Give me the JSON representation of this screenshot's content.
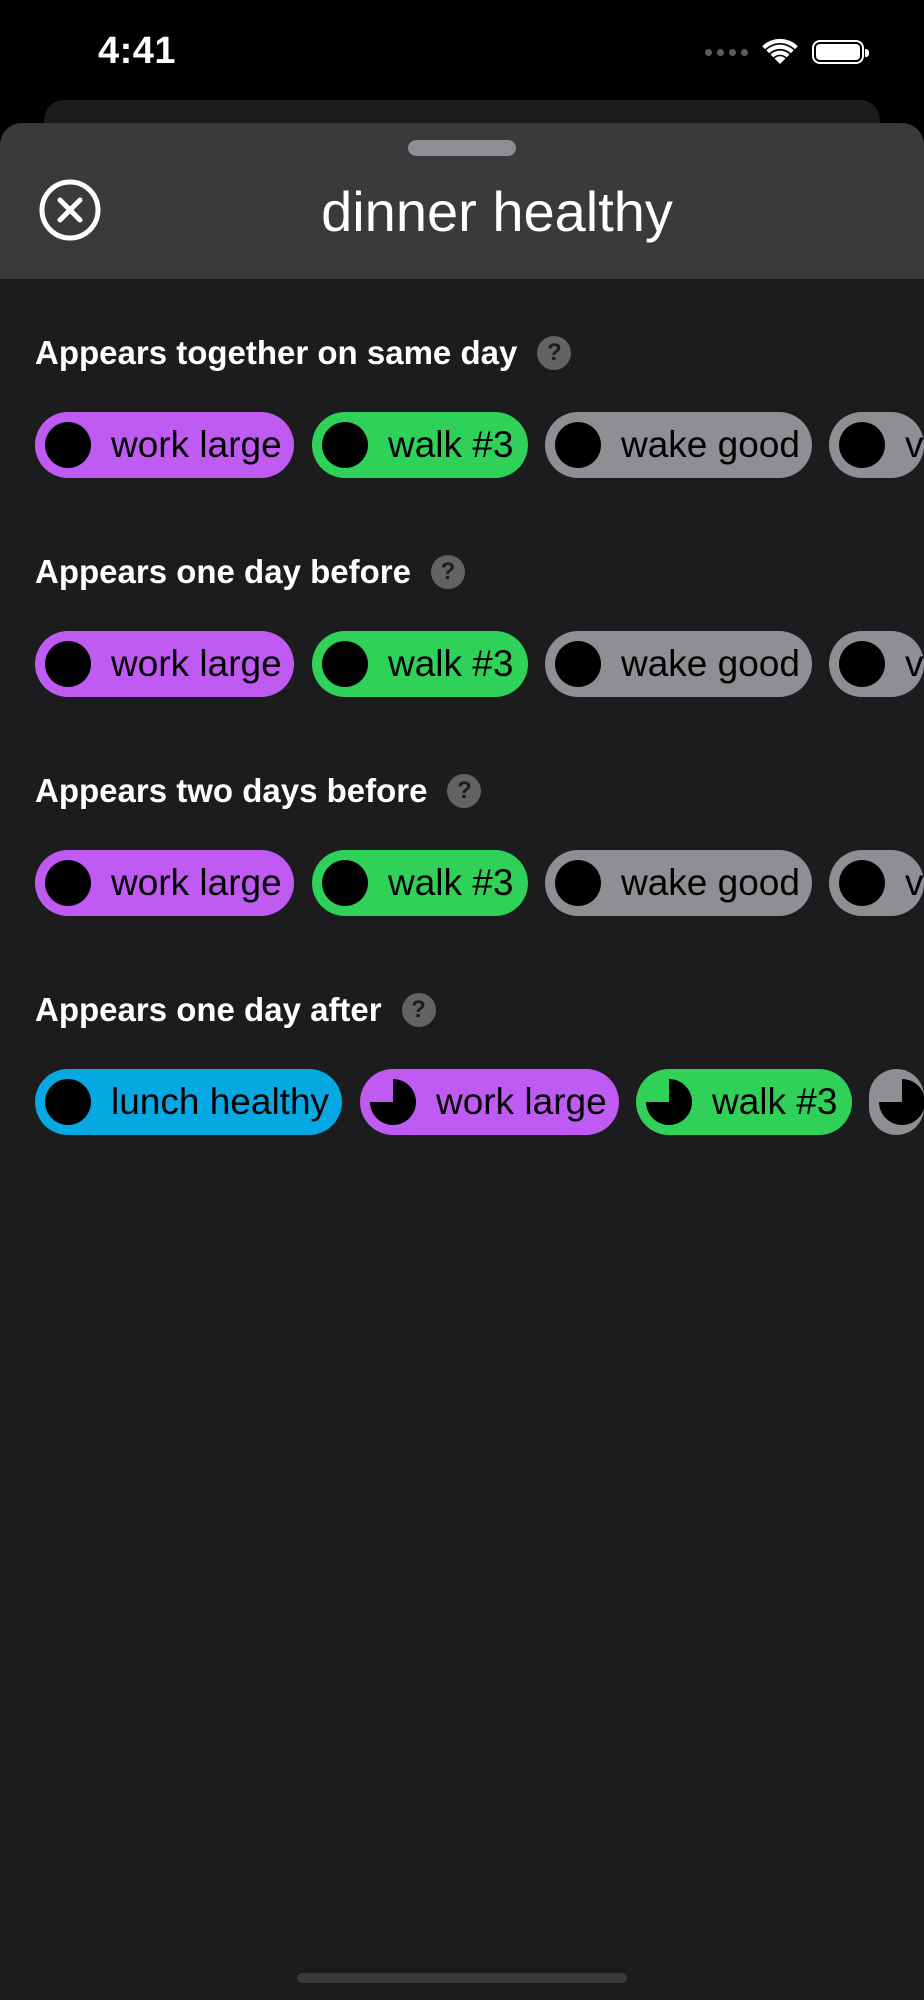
{
  "status_bar": {
    "time": "4:41"
  },
  "header": {
    "title": "dinner healthy",
    "close_icon": "xmark-circle-icon"
  },
  "colors": {
    "purple": "#BF5AF2",
    "green": "#30D158",
    "gray": "#8E8E93",
    "blue": "#05A8E0",
    "sheet_background": "#1C1C1E",
    "header_background": "#3A3A3C"
  },
  "sections": [
    {
      "title": "Appears together on same day",
      "help_icon": "question-mark-icon",
      "chips": [
        {
          "label": "work large",
          "color": "#BF5AF2"
        },
        {
          "label": "walk #3",
          "color": "#30D158"
        },
        {
          "label": "wake good",
          "color": "#8E8E93"
        },
        {
          "label": "vi",
          "color": "#8E8E93"
        }
      ]
    },
    {
      "title": "Appears one day before",
      "help_icon": "question-mark-icon",
      "chips": [
        {
          "label": "work large",
          "color": "#BF5AF2"
        },
        {
          "label": "walk #3",
          "color": "#30D158"
        },
        {
          "label": "wake good",
          "color": "#8E8E93"
        },
        {
          "label": "vi",
          "color": "#8E8E93"
        }
      ]
    },
    {
      "title": "Appears two days before",
      "help_icon": "question-mark-icon",
      "chips": [
        {
          "label": "work large",
          "color": "#BF5AF2"
        },
        {
          "label": "walk #3",
          "color": "#30D158"
        },
        {
          "label": "wake good",
          "color": "#8E8E93"
        },
        {
          "label": "vi",
          "color": "#8E8E93"
        }
      ]
    },
    {
      "title": "Appears one day after",
      "help_icon": "question-mark-icon",
      "chips": [
        {
          "label": "lunch healthy",
          "color": "#05A8E0",
          "fill_fraction": 1.0
        },
        {
          "label": "work large",
          "color": "#BF5AF2",
          "fill_fraction": 0.75
        },
        {
          "label": "walk #3",
          "color": "#30D158",
          "fill_fraction": 0.75
        },
        {
          "label": "",
          "color": "#8E8E93",
          "fill_fraction": 0.75
        }
      ]
    }
  ]
}
